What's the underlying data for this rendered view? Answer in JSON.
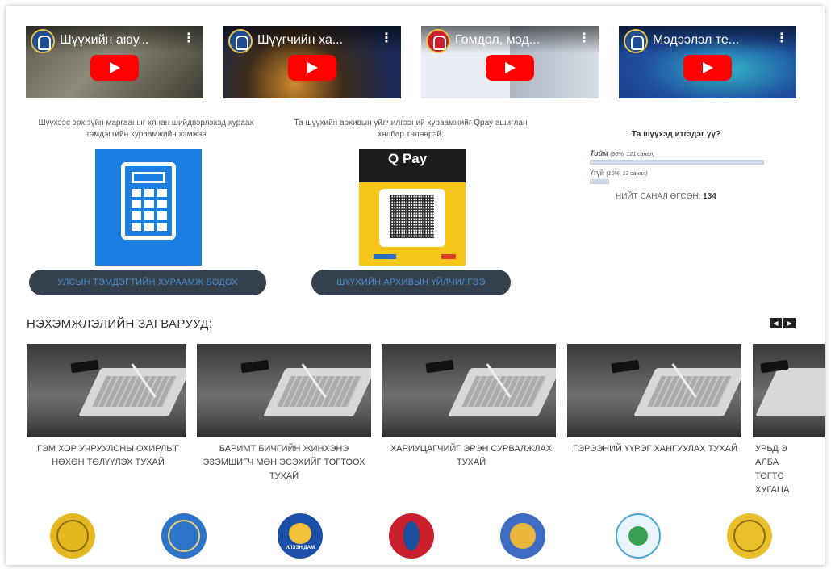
{
  "videos": [
    {
      "title": "Шүүхийн аюу..."
    },
    {
      "title": "Шүүгчийн ха..."
    },
    {
      "title": "Гомдол, мэд..."
    },
    {
      "title": "Мэдээлэл те..."
    }
  ],
  "fee_calc": {
    "caption": "Шүүхээс эрх зүйн маргааныг хянан шийдвэрлэхэд хураах тэмдэгтийн хураамжийн хэмжээ",
    "button": "УЛСЫН ТЭМДЭГТИЙН ХУРААМЖ БОДОХ",
    "icon": "calculator-icon"
  },
  "archive": {
    "caption": "Та шүүхийн архивын үйлчилгээний хураамжийг Qpay ашиглан хялбар төлөөрэй:",
    "qpay_logo": "Q Pay",
    "button": "ШҮҮХИЙН АРХИВЫН ҮЙЛЧИЛГЭЭ"
  },
  "poll": {
    "question": "Та шүүхэд итгэдэг үү?",
    "options": [
      {
        "label": "Тийм",
        "detail": "(90%, 121 санал)",
        "percent": 90
      },
      {
        "label": "Үгүй",
        "detail": "(10%, 13 санал)",
        "percent": 10
      }
    ],
    "total_label": "НИЙТ САНАЛ ӨГСӨН:",
    "total_value": "134"
  },
  "templates": {
    "heading": "НЭХЭМЖЛЭЛИЙН ЗАГВАРУУД:",
    "prev": "◀",
    "next": "▶",
    "items": [
      {
        "title": "ГЭМ ХОР УЧРУУЛСНЫ ОХИРЛЫГ НӨХӨН ТӨЛҮҮЛЭХ ТУХАЙ"
      },
      {
        "title": "БАРИМТ БИЧГИЙН ЖИНХЭНЭ ЭЗЭМШИГЧ МӨН ЭСЭХИЙГ ТОГТООХ ТУХАЙ"
      },
      {
        "title": "ХАРИУЦАГЧИЙГ ЭРЭН СУРВАЛЖЛАХ ТУХАЙ"
      },
      {
        "title": "ГЭРЭЭНИЙ ҮҮРЭГ ХАНГУУЛАХ ТУХАЙ"
      },
      {
        "title": "УРЬД Э АЛБА ТОГТС ХУГАЦА"
      }
    ]
  },
  "logos": [
    {
      "name": "court-scales-logo",
      "color": "#e3b821"
    },
    {
      "name": "judicial-council-logo",
      "color": "#2b74c7"
    },
    {
      "name": "mongolia-emblem-logo",
      "color": "#1c4fa8",
      "label": "ИЛЗЭН ДАМ"
    },
    {
      "name": "soyombo-logo",
      "color": "#c8202c"
    },
    {
      "name": "state-emblem-logo",
      "color": "#3d6cc2"
    },
    {
      "name": "ministry-globe-logo",
      "color": "#4fa3d9"
    },
    {
      "name": "court-scales-gold-logo",
      "color": "#e9bf2c"
    }
  ]
}
